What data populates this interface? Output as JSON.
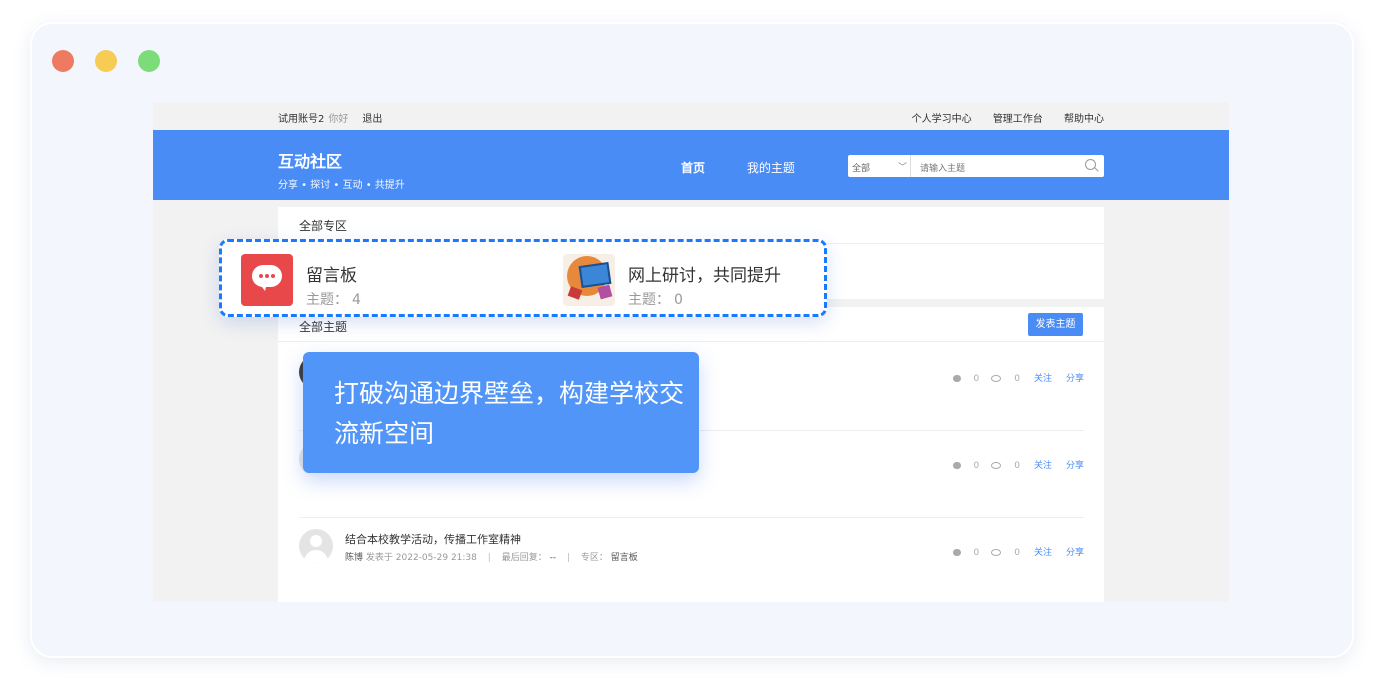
{
  "window": {
    "controls": [
      "close",
      "minimize",
      "maximize"
    ]
  },
  "topbar": {
    "account": "试用账号2",
    "greeting": "你好",
    "logout": "退出",
    "links": [
      "个人学习中心",
      "管理工作台",
      "帮助中心"
    ]
  },
  "header": {
    "title": "互动社区",
    "subtitle": "分享 • 探讨 • 互动 • 共提升",
    "nav": [
      {
        "label": "首页",
        "active": true
      },
      {
        "label": "我的主题",
        "active": false
      }
    ],
    "search": {
      "scope": "全部",
      "placeholder": "请输入主题"
    },
    "color": "#4a8cf6"
  },
  "zones": {
    "heading": "全部专区",
    "items": [
      {
        "name": "留言板",
        "count_label": "主题：",
        "count": "4",
        "icon": "chat-bubble-icon"
      },
      {
        "name": "网上研讨，共同提升",
        "count_label": "主题：",
        "count": "0",
        "icon": "discussion-art-icon"
      }
    ]
  },
  "topics": {
    "heading": "全部主题",
    "post_button": "发表主题",
    "items": [
      {
        "title": "",
        "author": "",
        "posted_label": "",
        "posted": "",
        "reply_label": "",
        "reply": "",
        "zone_label": "",
        "zone": "",
        "comments": "0",
        "views": "0",
        "follow": "关注",
        "share": "分享"
      },
      {
        "title": "",
        "author": "",
        "posted_label": "",
        "posted": "",
        "reply_label": "",
        "reply": "",
        "zone_label": "",
        "zone": "",
        "comments": "0",
        "views": "0",
        "follow": "关注",
        "share": "分享"
      },
      {
        "title": "结合本校教学活动，传播工作室精神",
        "author": "陈博",
        "posted_label": "发表于",
        "posted": "2022-05-29 21:38",
        "reply_label": "最后回复：",
        "reply": "--",
        "zone_label": "专区：",
        "zone": "留言板",
        "comments": "0",
        "views": "0",
        "follow": "关注",
        "share": "分享"
      }
    ]
  },
  "banner": {
    "text": "打破沟通边界壁垒，构建学校交流新空间"
  }
}
